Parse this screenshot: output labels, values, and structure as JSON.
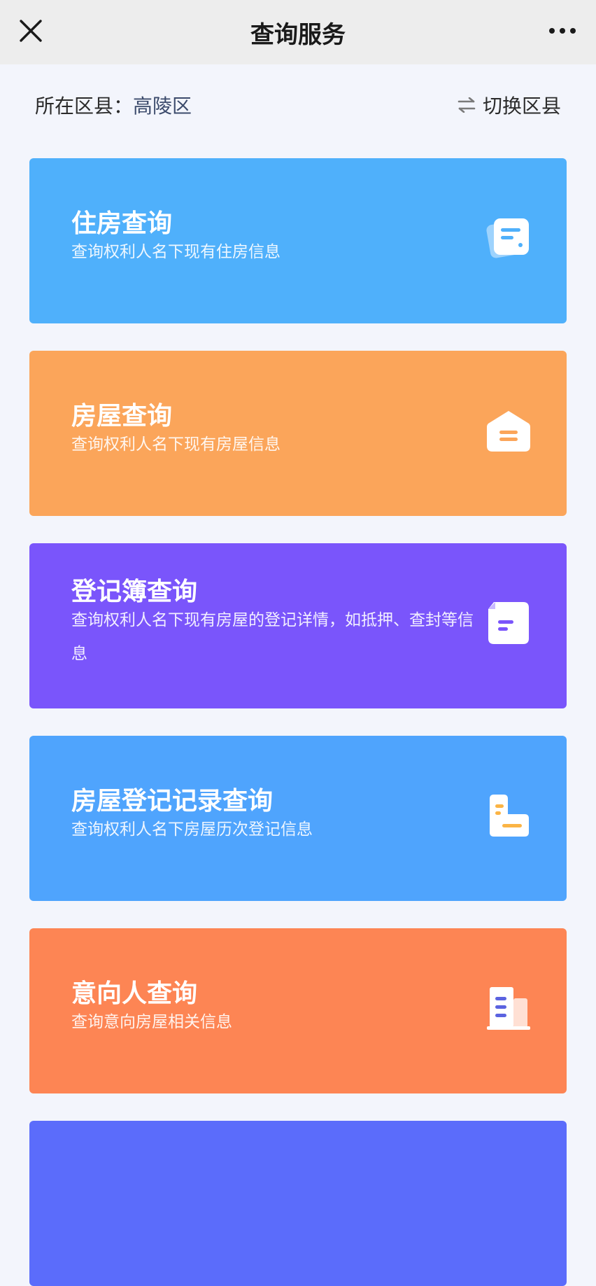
{
  "header": {
    "title": "查询服务"
  },
  "district": {
    "label": "所在区县：",
    "value": "高陵区",
    "switch_label": "切换区县"
  },
  "cards": [
    {
      "title": "住房查询",
      "desc": "查询权利人名下现有住房信息",
      "color": "#4fb0fb",
      "icon": "document-list-icon"
    },
    {
      "title": "房屋查询",
      "desc": "查询权利人名下现有房屋信息",
      "color": "#fba55a",
      "icon": "house-icon"
    },
    {
      "title": "登记簿查询",
      "desc": "查询权利人名下现有房屋的登记详情，如抵押、查封等信息",
      "color": "#7a55fb",
      "icon": "ledger-icon"
    },
    {
      "title": "房屋登记记录查询",
      "desc": "查询权利人名下房屋历次登记信息",
      "color": "#4fa4fd",
      "icon": "record-icon"
    },
    {
      "title": "意向人查询",
      "desc": "查询意向房屋相关信息",
      "color": "#fd8554",
      "icon": "building-icon"
    },
    {
      "title": "",
      "desc": "",
      "color": "#5b6cfb",
      "icon": ""
    }
  ]
}
